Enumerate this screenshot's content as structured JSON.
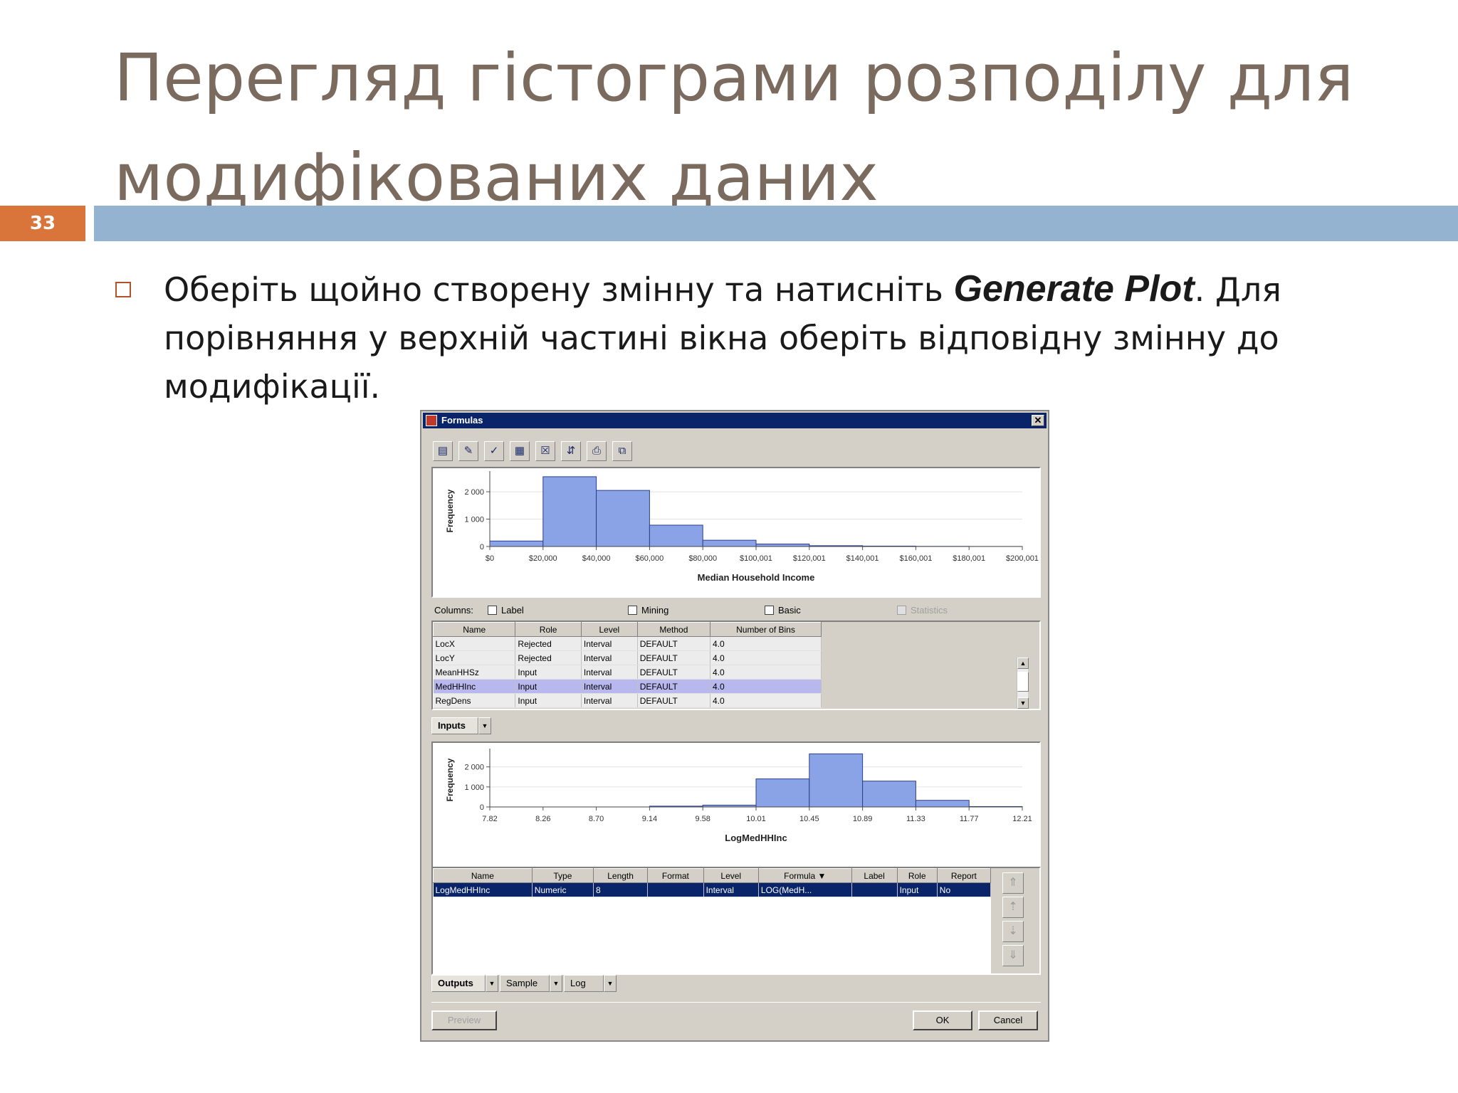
{
  "slide": {
    "title": "Перегляд гістограми розподілу для модифікованих даних",
    "number": "33",
    "bullet_pre": "Оберіть щойно створену змінну та натисніть ",
    "bullet_bold": "Generate Plot",
    "bullet_post": ". Для порівняння у верхній частині вікна оберіть відповідну змінну до модифікації."
  },
  "window": {
    "title": "Formulas",
    "close_label": "✕",
    "toolbar_icons": [
      "properties-icon",
      "edit-icon",
      "check-icon",
      "calculator-icon",
      "delete-formula-icon",
      "sort-icon",
      "print-icon",
      "copy-icon"
    ],
    "toolbar_glyphs": [
      "▤",
      "✎",
      "✓",
      "▦",
      "☒",
      "⇵",
      "⎙",
      "⧉"
    ],
    "columns_label": "Columns:",
    "checkboxes": [
      {
        "label": "Label",
        "disabled": false
      },
      {
        "label": "Mining",
        "disabled": false
      },
      {
        "label": "Basic",
        "disabled": false
      },
      {
        "label": "Statistics",
        "disabled": true
      }
    ],
    "input_table": {
      "headers": [
        "Name",
        "Role",
        "Level",
        "Method",
        "Number of Bins"
      ],
      "rows": [
        [
          "LocX",
          "Rejected",
          "Interval",
          "DEFAULT",
          "4.0"
        ],
        [
          "LocY",
          "Rejected",
          "Interval",
          "DEFAULT",
          "4.0"
        ],
        [
          "MeanHHSz",
          "Input",
          "Interval",
          "DEFAULT",
          "4.0"
        ],
        [
          "MedHHInc",
          "Input",
          "Interval",
          "DEFAULT",
          "4.0"
        ],
        [
          "RegDens",
          "Input",
          "Interval",
          "DEFAULT",
          "4.0"
        ]
      ],
      "selected_row": 3
    },
    "inputs_tab": "Inputs",
    "output_table": {
      "headers": [
        "Name",
        "Type",
        "Length",
        "Format",
        "Level",
        "Formula ▼",
        "Label",
        "Role",
        "Report"
      ],
      "rows": [
        [
          "LogMedHHInc",
          "Numeric",
          "8",
          "",
          "Interval",
          "LOG(MedH...",
          "",
          "Input",
          "No"
        ]
      ],
      "selected_row": 0
    },
    "bottom_tabs": [
      "Outputs",
      "Sample",
      "Log"
    ],
    "buttons": {
      "preview": "Preview",
      "ok": "OK",
      "cancel": "Cancel"
    }
  },
  "chart_data": [
    {
      "type": "bar",
      "xlabel": "Median Household Income",
      "ylabel": "Frequency",
      "ylim": [
        0,
        2600
      ],
      "yticks": [
        "0",
        "1 000",
        "2 000"
      ],
      "ytick_values": [
        0,
        1000,
        2000
      ],
      "tick_labels": [
        "$0",
        "$20,000",
        "$40,000",
        "$60,000",
        "$80,000",
        "$100,001",
        "$120,001",
        "$140,001",
        "$160,001",
        "$180,001",
        "$200,001"
      ],
      "values": [
        200,
        2550,
        2050,
        780,
        230,
        90,
        30,
        15,
        5,
        2
      ],
      "color": "#8aa3e6"
    },
    {
      "type": "bar",
      "xlabel": "LogMedHHInc",
      "ylabel": "Frequency",
      "ylim": [
        0,
        2700
      ],
      "yticks": [
        "0",
        "1 000",
        "2 000"
      ],
      "ytick_values": [
        0,
        1000,
        2000
      ],
      "tick_labels": [
        "7.82",
        "8.26",
        "8.70",
        "9.14",
        "9.58",
        "10.01",
        "10.45",
        "10.89",
        "11.33",
        "11.77",
        "12.21"
      ],
      "values": [
        0,
        0,
        0,
        40,
        90,
        1400,
        2650,
        1290,
        330,
        20
      ],
      "color": "#8aa3e6"
    }
  ]
}
